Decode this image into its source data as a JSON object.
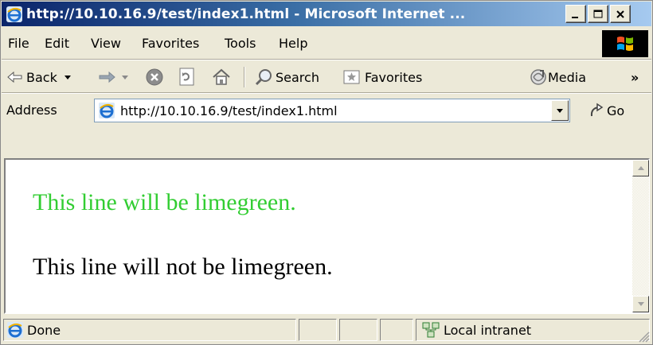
{
  "window": {
    "title": "http://10.10.16.9/test/index1.html - Microsoft Internet ...",
    "title_gradient_colors": [
      "#0a246a",
      "#a6caf0"
    ]
  },
  "menu": {
    "items": [
      {
        "label": "File"
      },
      {
        "label": "Edit"
      },
      {
        "label": "View"
      },
      {
        "label": "Favorites"
      },
      {
        "label": "Tools"
      },
      {
        "label": "Help"
      }
    ]
  },
  "toolbar": {
    "back_label": "Back",
    "search_label": "Search",
    "favorites_label": "Favorites",
    "media_label": "Media",
    "more_glyph": "»",
    "icons": [
      "back-arrow-icon",
      "forward-arrow-icon",
      "stop-icon",
      "refresh-icon",
      "home-icon",
      "search-icon",
      "favorites-icon",
      "media-icon"
    ]
  },
  "address": {
    "label": "Address",
    "url": "http://10.10.16.9/test/index1.html",
    "go_label": "Go"
  },
  "content": {
    "line1": "This line will be limegreen.",
    "line1_color": "#32cd32",
    "line2": "This line will not be limegreen.",
    "line2_color": "#000000"
  },
  "status": {
    "text": "Done",
    "zone": "Local intranet"
  }
}
